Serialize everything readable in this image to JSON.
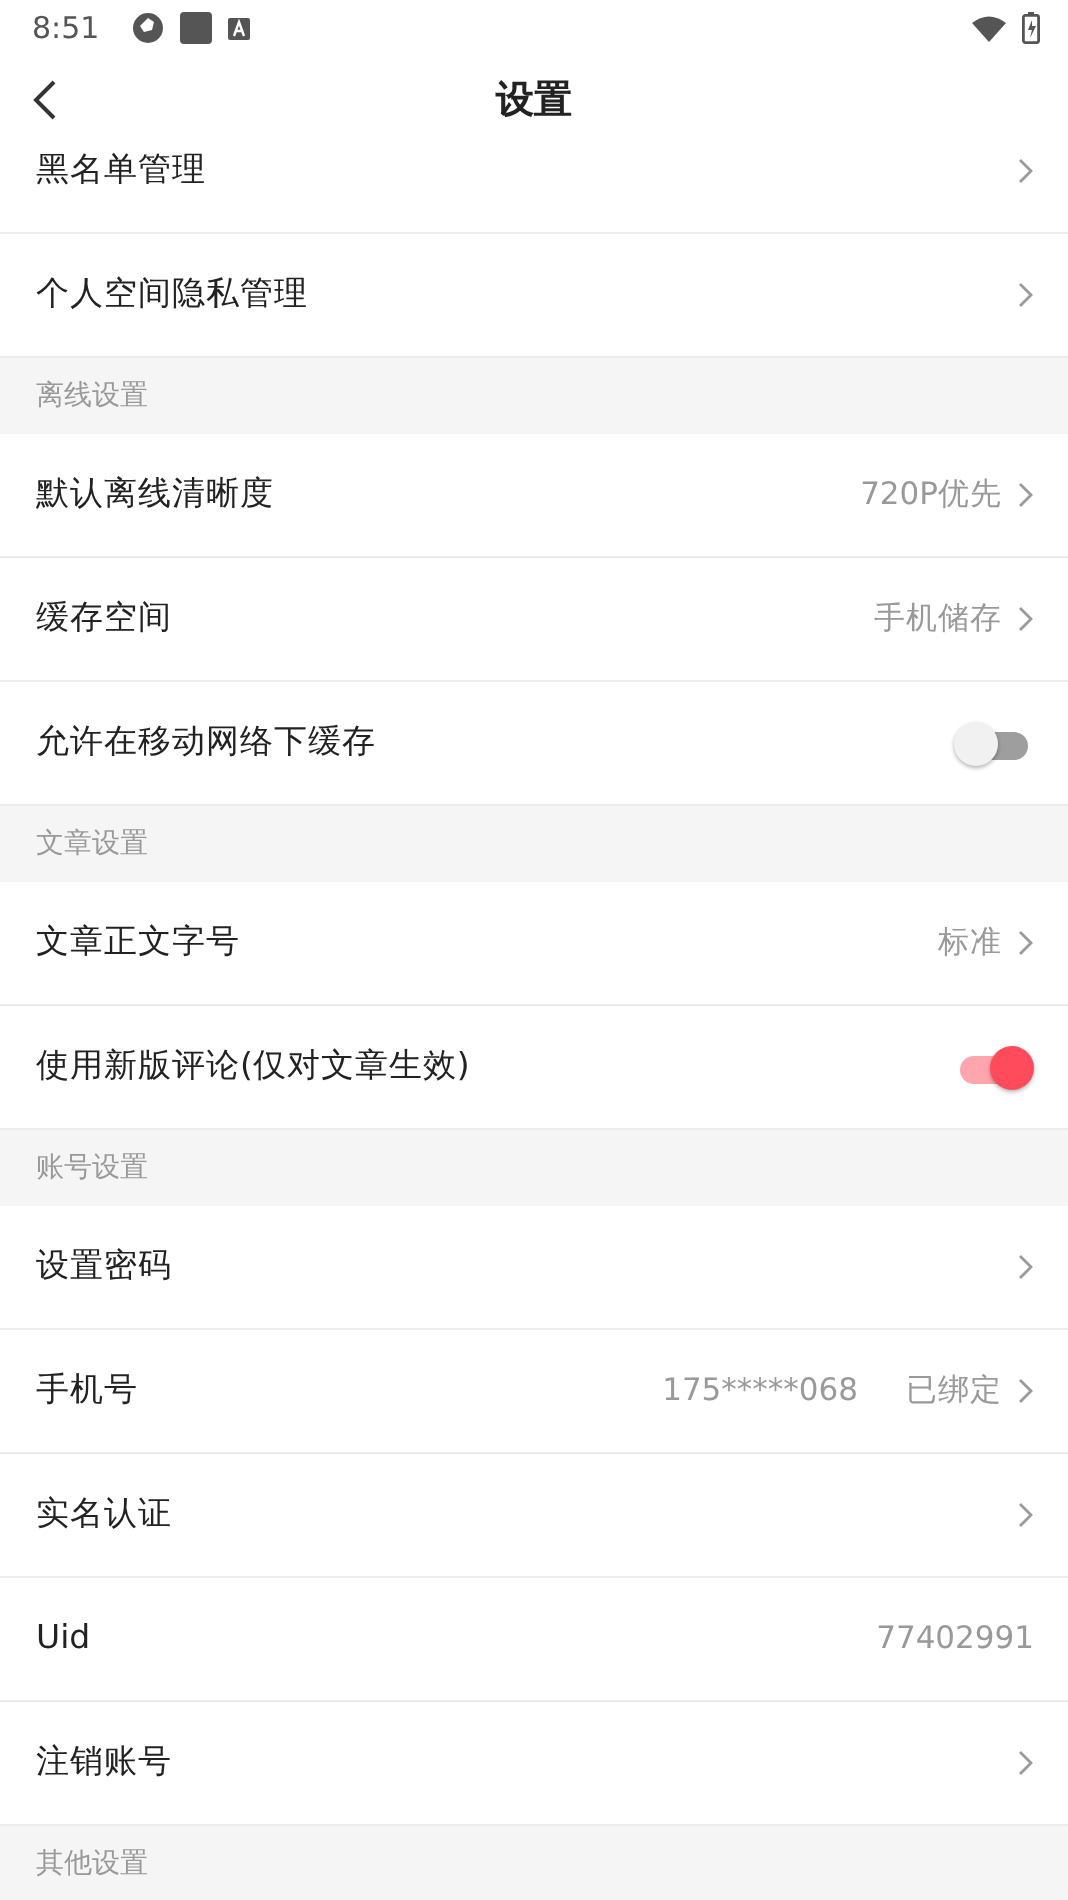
{
  "status_bar": {
    "time": "8:51"
  },
  "header": {
    "title": "设置"
  },
  "items": [
    {
      "kind": "row",
      "label": "黑名单管理",
      "chevron": true
    },
    {
      "kind": "row",
      "label": "个人空间隐私管理",
      "chevron": true
    },
    {
      "kind": "section",
      "label": "离线设置"
    },
    {
      "kind": "row",
      "label": "默认离线清晰度",
      "value": "720P优先",
      "chevron": true
    },
    {
      "kind": "row",
      "label": "缓存空间",
      "value": "手机储存",
      "chevron": true
    },
    {
      "kind": "toggle",
      "label": "允许在移动网络下缓存",
      "on": false
    },
    {
      "kind": "section",
      "label": "文章设置"
    },
    {
      "kind": "row",
      "label": "文章正文字号",
      "value": "标准",
      "chevron": true
    },
    {
      "kind": "toggle",
      "label": "使用新版评论(仅对文章生效)",
      "on": true
    },
    {
      "kind": "section",
      "label": "账号设置"
    },
    {
      "kind": "row",
      "label": "设置密码",
      "chevron": true
    },
    {
      "kind": "row",
      "label": "手机号",
      "detail": "175*****068",
      "value": "已绑定",
      "chevron": true
    },
    {
      "kind": "row",
      "label": "实名认证",
      "chevron": true
    },
    {
      "kind": "row",
      "label": "Uid",
      "value": "77402991",
      "chevron": false
    },
    {
      "kind": "row",
      "label": "注销账号",
      "chevron": true
    },
    {
      "kind": "section",
      "label": "其他设置"
    }
  ]
}
